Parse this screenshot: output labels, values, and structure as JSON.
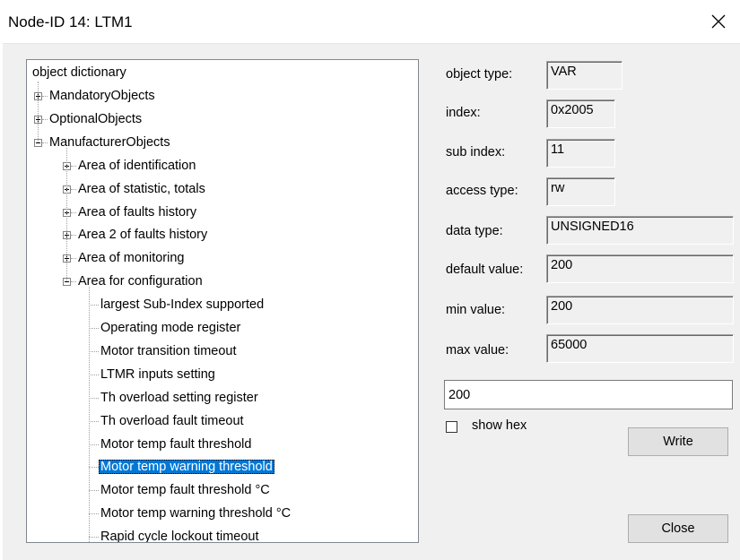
{
  "window": {
    "title": "Node-ID 14: LTM1",
    "close_glyph": "✕"
  },
  "tree": {
    "root": "object dictionary",
    "items": [
      {
        "label": "MandatoryObjects",
        "level": 1,
        "expander": "plus"
      },
      {
        "label": "OptionalObjects",
        "level": 1,
        "expander": "plus"
      },
      {
        "label": "ManufacturerObjects",
        "level": 1,
        "expander": "minus"
      },
      {
        "label": "Area of identification",
        "level": 2,
        "expander": "plus"
      },
      {
        "label": "Area of statistic, totals",
        "level": 2,
        "expander": "plus"
      },
      {
        "label": "Area of faults history",
        "level": 2,
        "expander": "plus"
      },
      {
        "label": "Area 2 of faults history",
        "level": 2,
        "expander": "plus"
      },
      {
        "label": "Area of monitoring",
        "level": 2,
        "expander": "plus"
      },
      {
        "label": "Area for configuration",
        "level": 2,
        "expander": "minus"
      },
      {
        "label": "largest Sub-Index supported",
        "level": 3,
        "expander": "none"
      },
      {
        "label": "Operating mode register",
        "level": 3,
        "expander": "none"
      },
      {
        "label": "Motor transition timeout",
        "level": 3,
        "expander": "none"
      },
      {
        "label": "LTMR inputs setting",
        "level": 3,
        "expander": "none"
      },
      {
        "label": "Th overload setting register",
        "level": 3,
        "expander": "none"
      },
      {
        "label": "Th overload fault timeout",
        "level": 3,
        "expander": "none"
      },
      {
        "label": "Motor temp fault threshold",
        "level": 3,
        "expander": "none"
      },
      {
        "label": "Motor temp warning threshold",
        "level": 3,
        "expander": "none",
        "selected": true
      },
      {
        "label": "Motor temp fault threshold °C",
        "level": 3,
        "expander": "none"
      },
      {
        "label": "Motor temp warning threshold °C",
        "level": 3,
        "expander": "none"
      },
      {
        "label": "Rapid cycle lockout timeout",
        "level": 3,
        "expander": "none"
      }
    ]
  },
  "properties": {
    "object_type_label": "object type:",
    "object_type": "VAR",
    "index_label": "index:",
    "index": "0x2005",
    "sub_index_label": "sub index:",
    "sub_index": "11",
    "access_type_label": "access type:",
    "access_type": "rw",
    "data_type_label": "data type:",
    "data_type": "UNSIGNED16",
    "default_value_label": "default value:",
    "default_value": "200",
    "min_value_label": "min value:",
    "min_value": "200",
    "max_value_label": "max value:",
    "max_value": "65000"
  },
  "editor": {
    "value": "200",
    "show_hex_label": "show hex",
    "show_hex_checked": false,
    "write_label": "Write",
    "close_label": "Close"
  },
  "colors": {
    "selection": "#0078d7",
    "dialog_bg": "#f0f0f0"
  }
}
